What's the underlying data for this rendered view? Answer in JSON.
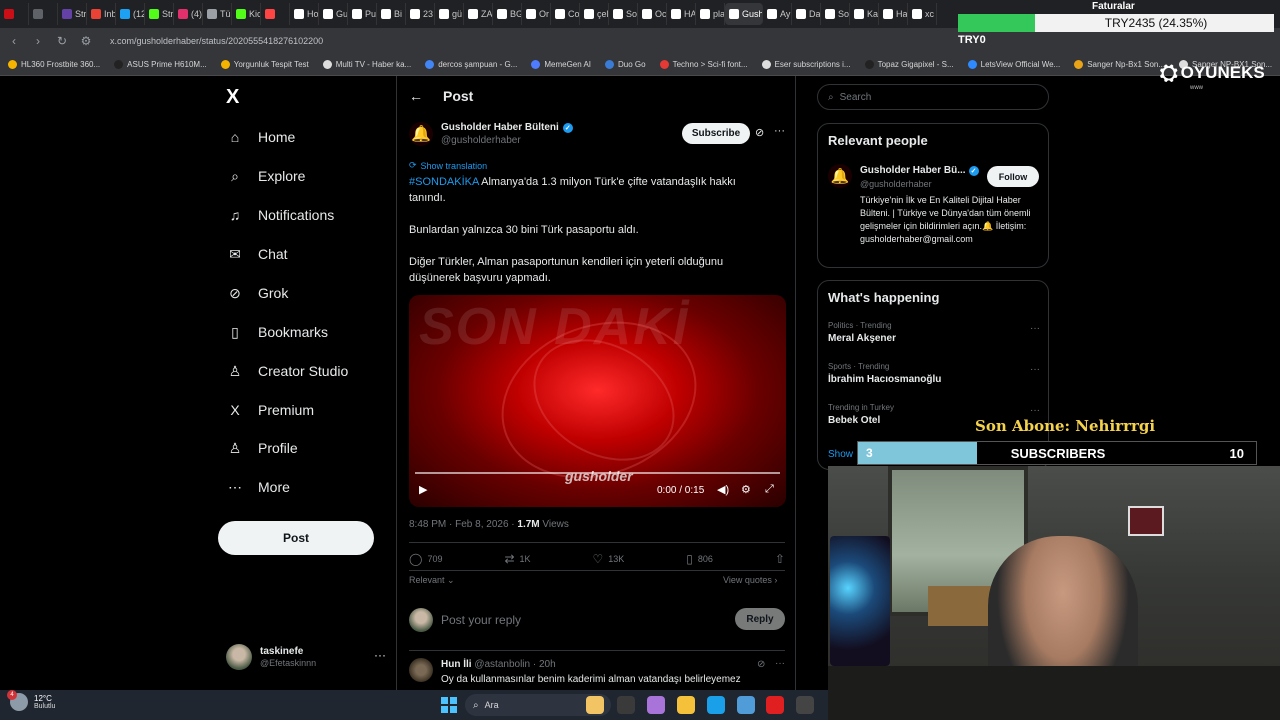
{
  "browser": {
    "tabs": [
      {
        "label": "",
        "color": "#cc0f16"
      },
      {
        "label": "",
        "color": "#5f6368"
      },
      {
        "label": "Str",
        "color": "#6441a5"
      },
      {
        "label": "Inb",
        "color": "#ea4335"
      },
      {
        "label": "(12",
        "color": "#1da1f2"
      },
      {
        "label": "Str",
        "color": "#53fc18"
      },
      {
        "label": "(4)",
        "color": "#e1306c"
      },
      {
        "label": "Tü",
        "color": "#9aa0a6"
      },
      {
        "label": "Kic",
        "color": "#53fc18"
      },
      {
        "label": "",
        "color": "#ff4444"
      },
      {
        "label": "Ho",
        "color": "#ffffff"
      },
      {
        "label": "Gu",
        "color": "#ffffff"
      },
      {
        "label": "Pu",
        "color": "#ffffff"
      },
      {
        "label": "Bi",
        "color": "#ffffff"
      },
      {
        "label": "23",
        "color": "#ffffff"
      },
      {
        "label": "gü",
        "color": "#ffffff"
      },
      {
        "label": "ZA",
        "color": "#ffffff"
      },
      {
        "label": "BG",
        "color": "#ffffff"
      },
      {
        "label": "Or",
        "color": "#ffffff"
      },
      {
        "label": "Co",
        "color": "#ffffff"
      },
      {
        "label": "çel",
        "color": "#ffffff"
      },
      {
        "label": "Sol",
        "color": "#ffffff"
      },
      {
        "label": "Oc",
        "color": "#ffffff"
      },
      {
        "label": "HA",
        "color": "#ffffff"
      },
      {
        "label": "pla",
        "color": "#ffffff"
      },
      {
        "label": "Gusho",
        "color": "#ffffff",
        "active": true
      },
      {
        "label": "Ay",
        "color": "#ffffff"
      },
      {
        "label": "Da",
        "color": "#ffffff"
      },
      {
        "label": "Sol",
        "color": "#ffffff"
      },
      {
        "label": "Ka",
        "color": "#ffffff"
      },
      {
        "label": "Ha",
        "color": "#ffffff"
      },
      {
        "label": "xc",
        "color": "#ffffff"
      }
    ],
    "url": "x.com/gusholderhaber/status/2020555418276102200",
    "bookmarks": [
      {
        "label": "HL360 Frostbite 360...",
        "color": "#f5b400"
      },
      {
        "label": "ASUS Prime H610M...",
        "color": "#222222"
      },
      {
        "label": "Yorgunluk Tespit Test",
        "color": "#f5b400"
      },
      {
        "label": "Multi TV - Haber ka...",
        "color": "#dddddd"
      },
      {
        "label": "dercos şampuan - G...",
        "color": "#4285f4"
      },
      {
        "label": "MemeGen AI",
        "color": "#4f7cff"
      },
      {
        "label": "Duo Go",
        "color": "#3a7bd5"
      },
      {
        "label": "Techno > Sci-fi font...",
        "color": "#e53935"
      },
      {
        "label": "Eser subscriptions i...",
        "color": "#dddddd"
      },
      {
        "label": "Topaz Gigapixel - S...",
        "color": "#222222"
      },
      {
        "label": "LetsView Official We...",
        "color": "#2e8bff"
      },
      {
        "label": "Sanger Np-Bx1 Son...",
        "color": "#e8a317"
      },
      {
        "label": "Sanger NP-BX1 Son...",
        "color": "#dddddd"
      }
    ]
  },
  "x": {
    "logo": "X",
    "nav": [
      {
        "label": "Home",
        "icon": "home-icon",
        "glyph": "⌂"
      },
      {
        "label": "Explore",
        "icon": "search-icon",
        "glyph": "⌕"
      },
      {
        "label": "Notifications",
        "icon": "bell-icon",
        "glyph": "♫"
      },
      {
        "label": "Chat",
        "icon": "mail-icon",
        "glyph": "✉"
      },
      {
        "label": "Grok",
        "icon": "grok-icon",
        "glyph": "⊘"
      },
      {
        "label": "Bookmarks",
        "icon": "bookmark-icon",
        "glyph": "▯"
      },
      {
        "label": "Creator Studio",
        "icon": "creator-icon",
        "glyph": "♙"
      },
      {
        "label": "Premium",
        "icon": "x-premium-icon",
        "glyph": "X"
      },
      {
        "label": "Profile",
        "icon": "person-icon",
        "glyph": "♙"
      },
      {
        "label": "More",
        "icon": "more-circle-icon",
        "glyph": "⋯"
      }
    ],
    "post_button": "Post",
    "account": {
      "name": "taskinefe",
      "handle": "@Efetaskinnn"
    },
    "header_title": "Post",
    "post": {
      "author_name": "Gusholder Haber Bülteni",
      "author_handle": "@gusholderhaber",
      "subscribe": "Subscribe",
      "show_translation": "Show translation",
      "hashtag": "#SONDAKİKA",
      "line1": " Almanya'da 1.3 milyon Türk'e çifte vatandaşlık hakkı tanındı.",
      "line2": "Bunlardan yalnızca 30 bini Türk pasaportu aldı.",
      "line3": "Diğer Türkler, Alman pasaportunun kendileri için yeterli olduğunu düşünerek başvuru yapmadı.",
      "video_overlay_text": "SON DAKİ",
      "video_watermark": "gusholder",
      "video_time": "0:00 / 0:15",
      "timestamp": "8:48 PM · Feb 8, 2026 · ",
      "views_count": "1.7M",
      "views_label": " Views",
      "replies": "709",
      "reposts": "1K",
      "likes": "13K",
      "bookmarks": "806",
      "relevant": "Relevant ⌄",
      "view_quotes": "View quotes ›",
      "reply_placeholder": "Post your reply",
      "reply_button": "Reply"
    },
    "comment": {
      "name": "Hun İli",
      "handle_time": " @astanbolin · 20h",
      "text": "Oy da kullanmasınlar benim kaderimi alman vatandaşı belirleyemez"
    },
    "search_placeholder": "Search",
    "relevant_people": {
      "title": "Relevant people",
      "name": "Gusholder Haber Bü...",
      "handle": "@gusholderhaber",
      "follow": "Follow",
      "bio": "Türkiye'nin İlk ve En Kaliteli Dijital Haber Bülteni. | Türkiye ve Dünya'dan tüm önemli gelişmeler için bildirimleri açın.🔔 İletişim: gusholderhaber@gmail.com"
    },
    "happening": {
      "title": "What's happening",
      "trends": [
        {
          "category": "Politics · Trending",
          "title": "Meral Akşener"
        },
        {
          "category": "Sports · Trending",
          "title": "İbrahim Hacıosmanoğlu"
        },
        {
          "category": "Trending in Turkey",
          "title": "Bebek Otel"
        }
      ],
      "show_more": "Show"
    }
  },
  "overlay": {
    "top_label": "Faturalar",
    "top_value": "TRY2435 (24.35%)",
    "top_progress_percent": 24.35,
    "top_current": "TRY0",
    "brand": "OYUNEKS",
    "brand_sub": "www",
    "last_sub_label": "Son Abone: Nehirrrgi",
    "subs_current": "3",
    "subs_label": "SUBSCRIBERS",
    "subs_goal": "10",
    "subs_fill_fraction": 0.3
  },
  "taskbar": {
    "temp": "12°C",
    "condition": "Bulutlu",
    "notification_count": "4",
    "search_placeholder": "Ara",
    "app_colors": [
      "#f2c464",
      "#3a3a3a",
      "#a874d9",
      "#f5c13b",
      "#1aa0e8",
      "#4f9cd9",
      "#e02020",
      "#444444"
    ]
  }
}
